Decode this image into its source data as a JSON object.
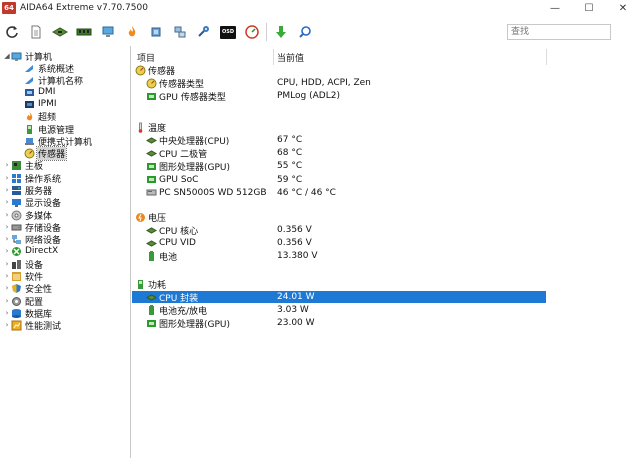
{
  "window": {
    "app_icon_text": "64",
    "title": "AIDA64 Extreme v7.70.7500",
    "minimize": "—",
    "maximize": "☐",
    "close": "✕"
  },
  "toolbar": {
    "icons": [
      "refresh-icon",
      "report-icon",
      "motherboard-icon",
      "memory-icon",
      "computer-icon",
      "flame-icon",
      "cpu-icon",
      "network-icon",
      "tools-icon",
      "osd-icon",
      "gauge-icon",
      "download-icon",
      "search-icon"
    ],
    "osd_label": "OSD",
    "search_placeholder": "查找"
  },
  "tree": {
    "items": [
      {
        "label": "计算机",
        "level": 0,
        "expander": "◢",
        "icon": "computer-icon"
      },
      {
        "label": "系统概述",
        "level": 1,
        "expander": "",
        "icon": "arrow-icon"
      },
      {
        "label": "计算机名称",
        "level": 1,
        "expander": "",
        "icon": "arrow-icon"
      },
      {
        "label": "DMI",
        "level": 1,
        "expander": "",
        "icon": "dmi-icon"
      },
      {
        "label": "IPMI",
        "level": 1,
        "expander": "",
        "icon": "ipmi-icon"
      },
      {
        "label": "超频",
        "level": 1,
        "expander": "",
        "icon": "flame-icon"
      },
      {
        "label": "电源管理",
        "level": 1,
        "expander": "",
        "icon": "power-icon"
      },
      {
        "label": "便携式计算机",
        "level": 1,
        "expander": "",
        "icon": "laptop-icon"
      },
      {
        "label": "传感器",
        "level": 1,
        "expander": "",
        "icon": "sensor-icon",
        "selected": true
      },
      {
        "label": "主板",
        "level": 0,
        "expander": "›",
        "icon": "motherboard-icon"
      },
      {
        "label": "操作系统",
        "level": 0,
        "expander": "›",
        "icon": "windows-icon"
      },
      {
        "label": "服务器",
        "level": 0,
        "expander": "›",
        "icon": "server-icon"
      },
      {
        "label": "显示设备",
        "level": 0,
        "expander": "›",
        "icon": "display-icon"
      },
      {
        "label": "多媒体",
        "level": 0,
        "expander": "›",
        "icon": "multimedia-icon"
      },
      {
        "label": "存储设备",
        "level": 0,
        "expander": "›",
        "icon": "storage-icon"
      },
      {
        "label": "网络设备",
        "level": 0,
        "expander": "›",
        "icon": "network-icon"
      },
      {
        "label": "DirectX",
        "level": 0,
        "expander": "›",
        "icon": "directx-icon"
      },
      {
        "label": "设备",
        "level": 0,
        "expander": "›",
        "icon": "devices-icon"
      },
      {
        "label": "软件",
        "level": 0,
        "expander": "›",
        "icon": "software-icon"
      },
      {
        "label": "安全性",
        "level": 0,
        "expander": "›",
        "icon": "security-icon"
      },
      {
        "label": "配置",
        "level": 0,
        "expander": "›",
        "icon": "config-icon"
      },
      {
        "label": "数据库",
        "level": 0,
        "expander": "›",
        "icon": "database-icon"
      },
      {
        "label": "性能测试",
        "level": 0,
        "expander": "›",
        "icon": "benchmark-icon"
      }
    ]
  },
  "list": {
    "headers": {
      "item": "项目",
      "value": "当前值"
    },
    "groups": [
      {
        "label": "传感器",
        "icon": "sensor-icon",
        "rows": [
          {
            "name": "传感器类型",
            "value": "CPU, HDD, ACPI, Zen",
            "icon": "sensor-icon"
          },
          {
            "name": "GPU 传感器类型",
            "value": "PMLog  (ADL2)",
            "icon": "gpu-icon"
          }
        ]
      },
      {
        "label": "温度",
        "icon": "thermometer-icon",
        "rows": [
          {
            "name": "中央处理器(CPU)",
            "value": "67 °C",
            "icon": "cpu-chip-icon"
          },
          {
            "name": "CPU 二极管",
            "value": "68 °C",
            "icon": "cpu-chip-icon"
          },
          {
            "name": "图形处理器(GPU)",
            "value": "55 °C",
            "icon": "gpu-icon"
          },
          {
            "name": "GPU SoC",
            "value": "59 °C",
            "icon": "gpu-icon"
          },
          {
            "name": "PC SN5000S WD 512GB",
            "value": "46 °C / 46 °C",
            "icon": "drive-icon"
          }
        ]
      },
      {
        "label": "电压",
        "icon": "voltage-icon",
        "rows": [
          {
            "name": "CPU 核心",
            "value": "0.356 V",
            "icon": "cpu-chip-icon"
          },
          {
            "name": "CPU VID",
            "value": "0.356 V",
            "icon": "cpu-chip-icon"
          },
          {
            "name": "电池",
            "value": "13.380 V",
            "icon": "battery-icon"
          }
        ]
      },
      {
        "label": "功耗",
        "icon": "power-icon",
        "rows": [
          {
            "name": "CPU 封装",
            "value": "24.01 W",
            "icon": "cpu-chip-icon",
            "selected": true
          },
          {
            "name": "电池充/放电",
            "value": "3.03 W",
            "icon": "battery-icon"
          },
          {
            "name": "图形处理器(GPU)",
            "value": "23.00 W",
            "icon": "gpu-icon"
          }
        ]
      }
    ]
  },
  "colors": {
    "selection": "#1e79d4",
    "tree_selection": "#d6d6d6",
    "app_icon": "#c0392b"
  }
}
